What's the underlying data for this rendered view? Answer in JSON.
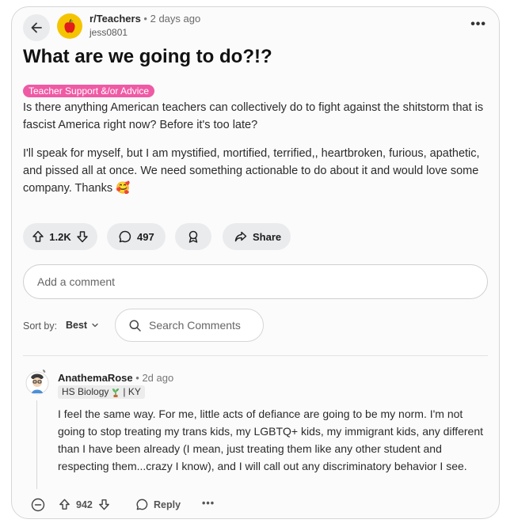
{
  "post": {
    "subreddit": "r/Teachers",
    "separator": "•",
    "age": "2 days ago",
    "author": "jess0801",
    "more": "•••",
    "title": "What are we going to do?!?",
    "flair": "Teacher Support &/or Advice",
    "body1": "Is there anything American teachers can collectively do to fight against the shitstorm that is fascist America right now? Before it's too late?",
    "body2": "I'll speak for myself, but I am mystified, mortified, terrified,, heartbroken, furious, apathetic, and pissed all at once. We need something actionable to do about it and would love some company. Thanks 🥰",
    "votes": "1.2K",
    "comments": "497",
    "share": "Share"
  },
  "comment_box": {
    "placeholder": "Add a comment"
  },
  "sort": {
    "label": "Sort by:",
    "value": "Best"
  },
  "search": {
    "placeholder": "Search Comments"
  },
  "comment": {
    "author": "AnathemaRose",
    "separator": "•",
    "age": "2d ago",
    "flair_left": "HS Biology",
    "flair_right": "| KY",
    "body": "I feel the same way. For me, little acts of defiance are going to be my norm. I'm not going to stop treating my trans kids, my LGBTQ+ kids, my immigrant kids, any different than I have been already (I mean, just treating them like any other student and respecting them...crazy I know), and I will call out any discriminatory behavior I see.",
    "votes": "942",
    "reply": "Reply",
    "more": "•••"
  },
  "colors": {
    "flair_bg": "#ef5aa5",
    "subreddit_icon_bg": "#f5c400"
  },
  "icons": [
    "back-arrow-icon",
    "apple-icon",
    "upvote-icon",
    "downvote-icon",
    "comment-icon",
    "award-icon",
    "share-icon",
    "search-icon",
    "chevron-down-icon",
    "collapse-icon",
    "plant-icon"
  ]
}
